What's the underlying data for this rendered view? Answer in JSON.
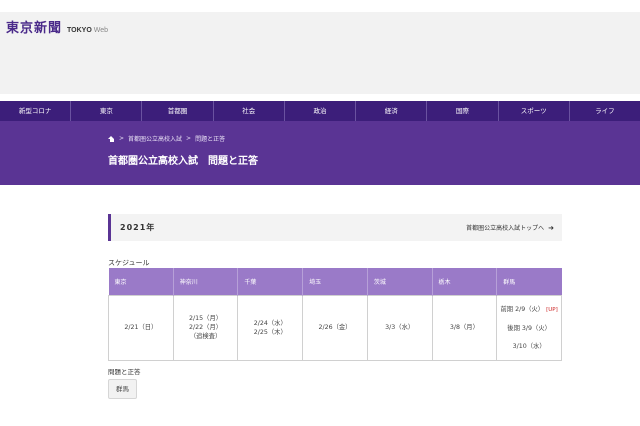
{
  "header": {
    "logo": "東京新聞",
    "logo_sub_strong": "TOKYO",
    "logo_sub_light": "Web"
  },
  "nav": {
    "items": [
      "新型コロナ",
      "東京",
      "首都圏",
      "社会",
      "政治",
      "経済",
      "国際",
      "スポーツ",
      "ライフ"
    ]
  },
  "breadcrumb": {
    "home_icon": "home-icon",
    "items": [
      "首都圏公立高校入試",
      "問題と正答"
    ],
    "separator": ">"
  },
  "page": {
    "title": "首都圏公立高校入試　問題と正答"
  },
  "year_section": {
    "year": "2021年",
    "top_link": "首都圏公立高校入試トップへ",
    "arrow_icon": "arrow-right-icon"
  },
  "schedule": {
    "label": "スケジュール",
    "headers": [
      "東京",
      "神奈川",
      "千葉",
      "埼玉",
      "茨城",
      "栃木",
      "群馬"
    ],
    "cells": [
      "2/21（日）",
      "2/15（月）\n2/22（月）\n（追検査）",
      "2/24（水）\n2/25（木）",
      "2/26（金）",
      "3/3（水）",
      "3/8（月）",
      ""
    ],
    "gunma": {
      "line1": "前期 2/9（火）",
      "up_tag": "[UP]",
      "line2": "後期 3/9（火）",
      "line3": "3/10（水）"
    },
    "colors": {
      "header_bg": "#9a7ac8",
      "up_tag": "#cc2222"
    }
  },
  "qa": {
    "label": "問題と正答",
    "button": "群馬"
  },
  "colors": {
    "nav_bg": "#3c1e7a",
    "hero_bg": "#5a3494",
    "accent": "#5a3494"
  }
}
